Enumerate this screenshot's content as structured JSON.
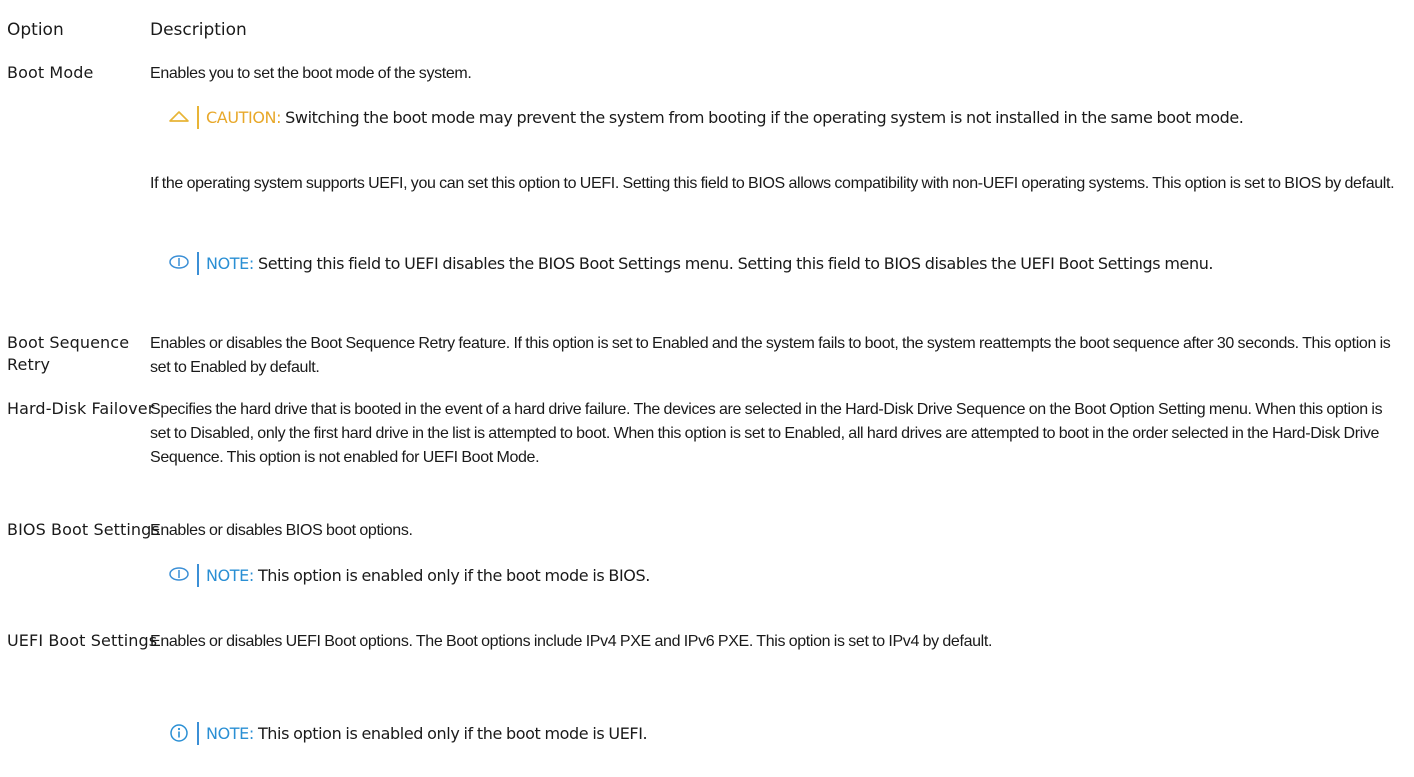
{
  "table": {
    "header": {
      "option": "Option",
      "description": "Description"
    },
    "rows": [
      {
        "option": "Boot Mode",
        "description": "Enables you to set the boot mode of the system.",
        "caution_label": "CAUTION:",
        "caution_text": "Switching the boot mode may prevent the system from booting if the operating system is not installed in the same boot mode.",
        "description2": "If the operating system supports UEFI, you can set this option to UEFI. Setting this field to BIOS allows compatibility with non-UEFI operating systems. This option is set to BIOS by default.",
        "note_label": "NOTE:",
        "note_text": "Setting this field to UEFI disables the BIOS Boot Settings menu. Setting this field to BIOS disables the UEFI Boot Settings menu."
      },
      {
        "option": "Boot Sequence Retry",
        "description": "Enables or disables the Boot Sequence Retry feature. If this option is set to Enabled and the system fails to boot, the system reattempts the boot sequence after 30 seconds. This option is set to Enabled by default."
      },
      {
        "option": "Hard-Disk Failover",
        "description": "Specifies the hard drive that is booted in the event of a hard drive failure. The devices are selected in the Hard-Disk Drive Sequence on the Boot Option Setting menu. When this option is set to Disabled, only the first hard drive in the list is attempted to boot. When this option is set to Enabled, all hard drives are attempted to boot in the order selected in the Hard-Disk Drive Sequence. This option is not enabled for UEFI Boot Mode."
      },
      {
        "option": "BIOS Boot Settings",
        "description": "Enables or disables BIOS boot options.",
        "note_label": "NOTE:",
        "note_text": "This option is enabled only if the boot mode is BIOS."
      },
      {
        "option": "UEFI Boot Settings",
        "description": "Enables or disables UEFI Boot options. The Boot options include IPv4 PXE and IPv6 PXE. This option is set to IPv4 by default.",
        "note_label": "NOTE:",
        "note_text": "This option is enabled only if the boot mode is UEFI."
      }
    ]
  },
  "icons": {
    "caution": "caution-triangle-icon",
    "note": "note-pill-icon",
    "info": "info-circle-icon"
  },
  "colors": {
    "note_accent": "#2a8fd4",
    "caution_accent": "#e8a82a"
  }
}
